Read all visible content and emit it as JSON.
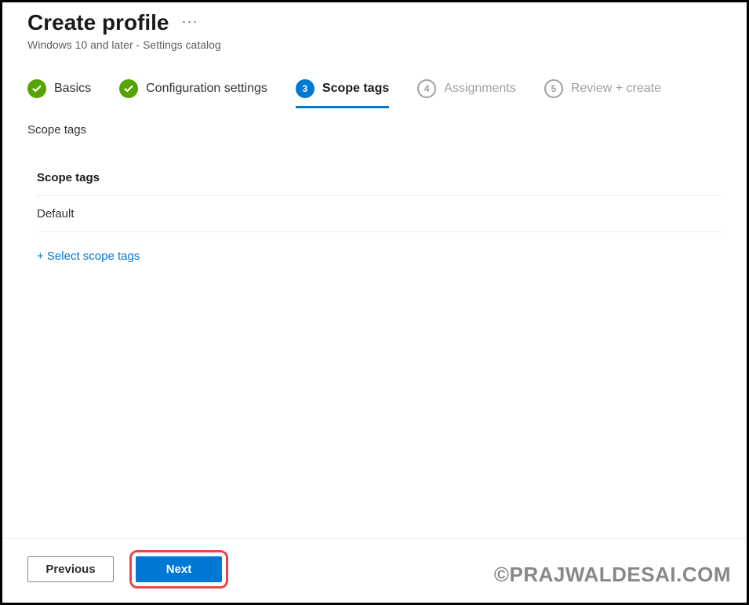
{
  "header": {
    "title": "Create profile",
    "subtitle": "Windows 10 and later - Settings catalog"
  },
  "wizard": {
    "steps": [
      {
        "label": "Basics",
        "state": "completed"
      },
      {
        "label": "Configuration settings",
        "state": "completed"
      },
      {
        "label": "Scope tags",
        "state": "current",
        "number": "3"
      },
      {
        "label": "Assignments",
        "state": "pending",
        "number": "4"
      },
      {
        "label": "Review + create",
        "state": "pending",
        "number": "5"
      }
    ]
  },
  "section": {
    "label": "Scope tags",
    "table_header": "Scope tags",
    "rows": [
      "Default"
    ],
    "add_link": "+ Select scope tags"
  },
  "footer": {
    "previous": "Previous",
    "next": "Next"
  },
  "watermark": "©PRAJWALDESAI.COM"
}
